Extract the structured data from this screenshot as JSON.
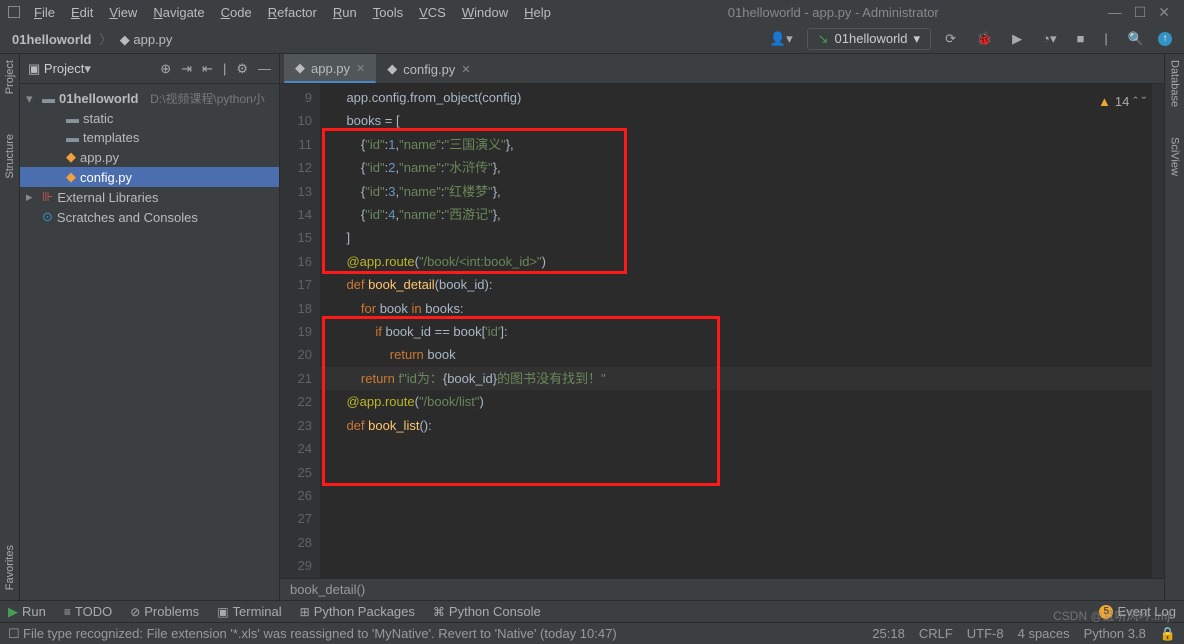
{
  "window": {
    "title": "01helloworld - app.py - Administrator"
  },
  "menu": [
    "File",
    "Edit",
    "View",
    "Navigate",
    "Code",
    "Refactor",
    "Run",
    "Tools",
    "VCS",
    "Window",
    "Help"
  ],
  "breadcrumb": {
    "project": "01helloworld",
    "file": "app.py"
  },
  "runconfig": {
    "name": "01helloworld"
  },
  "navIcons": [
    "user",
    "play",
    "debug",
    "run2",
    "coverage",
    "stop",
    "search",
    "update"
  ],
  "projectPane": {
    "title": "Project",
    "tree": {
      "root": {
        "name": "01helloworld",
        "path": "D:\\视频课程\\python小"
      },
      "children": [
        {
          "name": "static",
          "type": "folder"
        },
        {
          "name": "templates",
          "type": "folder"
        },
        {
          "name": "app.py",
          "type": "py"
        },
        {
          "name": "config.py",
          "type": "py",
          "selected": true
        }
      ],
      "ext": "External Libraries",
      "scratch": "Scratches and Consoles"
    }
  },
  "tabs": [
    {
      "name": "app.py",
      "active": true
    },
    {
      "name": "config.py",
      "active": false
    }
  ],
  "warnCount": "14",
  "code": {
    "startLine": 9,
    "lines": [
      {
        "n": 9,
        "seg": [
          [
            "txt",
            "    app.config.from_object(config)"
          ]
        ]
      },
      {
        "n": 10,
        "seg": [
          [
            "txt",
            ""
          ]
        ]
      },
      {
        "n": 11,
        "seg": [
          [
            "txt",
            "    books "
          ],
          [
            "op",
            "= ["
          ]
        ]
      },
      {
        "n": 12,
        "seg": [
          [
            "txt",
            "        {"
          ],
          [
            "str",
            "\"id\""
          ],
          [
            "op",
            ":"
          ],
          [
            "num",
            "1"
          ],
          [
            "op",
            ","
          ],
          [
            "str",
            "\"name\""
          ],
          [
            "op",
            ":"
          ],
          [
            "str",
            "\"三国演义\""
          ],
          [
            "op",
            "},"
          ]
        ]
      },
      {
        "n": 13,
        "seg": [
          [
            "txt",
            "        {"
          ],
          [
            "str",
            "\"id\""
          ],
          [
            "op",
            ":"
          ],
          [
            "num",
            "2"
          ],
          [
            "op",
            ","
          ],
          [
            "str",
            "\"name\""
          ],
          [
            "op",
            ":"
          ],
          [
            "str",
            "\"水浒传\""
          ],
          [
            "op",
            "},"
          ]
        ]
      },
      {
        "n": 14,
        "seg": [
          [
            "txt",
            "        {"
          ],
          [
            "str",
            "\"id\""
          ],
          [
            "op",
            ":"
          ],
          [
            "num",
            "3"
          ],
          [
            "op",
            ","
          ],
          [
            "str",
            "\"name\""
          ],
          [
            "op",
            ":"
          ],
          [
            "str",
            "\"红楼梦\""
          ],
          [
            "op",
            "},"
          ]
        ]
      },
      {
        "n": 15,
        "seg": [
          [
            "txt",
            "        {"
          ],
          [
            "str",
            "\"id\""
          ],
          [
            "op",
            ":"
          ],
          [
            "num",
            "4"
          ],
          [
            "op",
            ","
          ],
          [
            "str",
            "\"name\""
          ],
          [
            "op",
            ":"
          ],
          [
            "str",
            "\"西游记\""
          ],
          [
            "op",
            "},"
          ]
        ]
      },
      {
        "n": 16,
        "seg": [
          [
            "txt",
            "    ]"
          ]
        ]
      },
      {
        "n": 17,
        "seg": [
          [
            "txt",
            ""
          ]
        ]
      },
      {
        "n": 18,
        "seg": [
          [
            "txt",
            ""
          ]
        ]
      },
      {
        "n": 19,
        "seg": [
          [
            "txt",
            "    "
          ],
          [
            "dec",
            "@app.route"
          ],
          [
            "op",
            "("
          ],
          [
            "str",
            "\"/book/<int:book_id>\""
          ],
          [
            "op",
            ")"
          ]
        ]
      },
      {
        "n": 20,
        "seg": [
          [
            "txt",
            "    "
          ],
          [
            "kw",
            "def "
          ],
          [
            "fn",
            "book_detail"
          ],
          [
            "op",
            "(book_id):"
          ]
        ]
      },
      {
        "n": 21,
        "seg": [
          [
            "txt",
            "        "
          ],
          [
            "kw",
            "for "
          ],
          [
            "txt",
            "book "
          ],
          [
            "kw",
            "in "
          ],
          [
            "txt",
            "books:"
          ]
        ]
      },
      {
        "n": 22,
        "seg": [
          [
            "txt",
            "            "
          ],
          [
            "kw",
            "if "
          ],
          [
            "txt",
            "book_id "
          ],
          [
            "op",
            "== "
          ],
          [
            "txt",
            "book["
          ],
          [
            "str",
            "'id'"
          ],
          [
            "op",
            "]:"
          ]
        ]
      },
      {
        "n": 23,
        "seg": [
          [
            "txt",
            "                "
          ],
          [
            "kw",
            "return "
          ],
          [
            "txt",
            "book"
          ]
        ]
      },
      {
        "n": 24,
        "seg": [
          [
            "txt",
            ""
          ]
        ]
      },
      {
        "n": 25,
        "seg": [
          [
            "txt",
            "        "
          ],
          [
            "kw",
            "return "
          ],
          [
            "fstr",
            "f\"id为："
          ],
          [
            "op",
            "{"
          ],
          [
            "txt",
            "book_id"
          ],
          [
            "op",
            "}"
          ],
          [
            "fstr",
            "的图书没有找到！\""
          ]
        ],
        "cur": true
      },
      {
        "n": 26,
        "seg": [
          [
            "txt",
            ""
          ]
        ]
      },
      {
        "n": 27,
        "seg": [
          [
            "txt",
            ""
          ]
        ]
      },
      {
        "n": 28,
        "seg": [
          [
            "txt",
            "    "
          ],
          [
            "dec",
            "@app.route"
          ],
          [
            "op",
            "("
          ],
          [
            "str",
            "\"/book/list\""
          ],
          [
            "op",
            ")"
          ]
        ]
      },
      {
        "n": 29,
        "seg": [
          [
            "txt",
            "    "
          ],
          [
            "kw",
            "def "
          ],
          [
            "fn",
            "book_list"
          ],
          [
            "op",
            "():"
          ]
        ]
      }
    ],
    "breadcrumb": "book_detail()"
  },
  "leftBar": [
    "Project",
    "Structure",
    "Favorites"
  ],
  "rightBar": [
    "Database",
    "SciView"
  ],
  "bottomTools": [
    "Run",
    "TODO",
    "Problems",
    "Terminal",
    "Python Packages",
    "Python Console"
  ],
  "eventLog": "Event Log",
  "status": {
    "msg": "File type recognized: File extension '*.xls' was reassigned to 'MyNative'. Revert to 'Native' (today 10:47)",
    "pos": "25:18",
    "eol": "CRLF",
    "enc": "UTF-8",
    "indent": "4 spaces",
    "interp": "Python 3.8"
  },
  "watermark": "CSDN @且听风吟.tmj"
}
